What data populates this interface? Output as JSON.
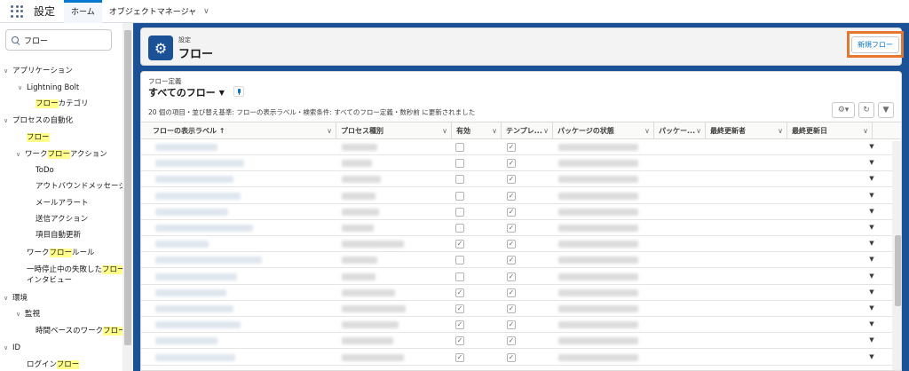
{
  "topbar": {
    "app_name": "設定",
    "tabs": [
      {
        "label": "ホーム",
        "active": true
      },
      {
        "label": "オブジェクトマネージャ",
        "active": false
      }
    ]
  },
  "sidebar": {
    "search_value": "フロー",
    "items": [
      {
        "caret": "∨",
        "text": "アプリケーション",
        "hl": ""
      },
      {
        "caret": "∨",
        "text": "Lightning Bolt",
        "hl": ""
      },
      {
        "pre": "",
        "hl": "フロー",
        "post": "カテゴリ"
      },
      {
        "caret": "∨",
        "text": "プロセスの自動化"
      },
      {
        "pre": "",
        "hl": "フロー",
        "post": ""
      },
      {
        "caret": "∨",
        "pre": "ワーク",
        "hl": "フロー",
        "post": "アクション"
      },
      {
        "text": "ToDo"
      },
      {
        "text": "アウトバウンドメッセージ"
      },
      {
        "text": "メールアラート"
      },
      {
        "text": "送信アクション"
      },
      {
        "text": "項目自動更新"
      },
      {
        "pre": "ワーク",
        "hl": "フロー",
        "post": "ルール"
      },
      {
        "pre": "一時停止中の失敗した",
        "hl": "フロー",
        "post": ""
      },
      {
        "text": "インタビュー"
      },
      {
        "caret": "∨",
        "text": "環境"
      },
      {
        "caret": "∨",
        "text": "監視"
      },
      {
        "pre": "時間ベースのワーク",
        "hl": "フロー",
        "post": ""
      },
      {
        "caret": "∨",
        "text": "ID"
      },
      {
        "pre": "ログイン",
        "hl": "フロー",
        "post": ""
      }
    ]
  },
  "header": {
    "breadcrumb": "設定",
    "title": "フロー",
    "new_button": "新規フロー",
    "icon": "gear-icon"
  },
  "list": {
    "label": "フロー定義",
    "view_name": "すべてのフロー",
    "status": "20 個の項目・並び替え基準: フローの表示ラベル・検索条件: すべてのフロー定義・数秒前 に更新されました"
  },
  "table": {
    "columns": [
      {
        "label": "フローの表示ラベル ↑"
      },
      {
        "label": "プロセス種別"
      },
      {
        "label": "有効"
      },
      {
        "label": "テンプレ..."
      },
      {
        "label": "パッケージの状態"
      },
      {
        "label": "パッケー..."
      },
      {
        "label": "最終更新者"
      },
      {
        "label": "最終更新日"
      }
    ],
    "rows": [
      {
        "active": false,
        "template": true
      },
      {
        "active": false,
        "template": true
      },
      {
        "active": false,
        "template": true
      },
      {
        "active": false,
        "template": true
      },
      {
        "active": false,
        "template": true
      },
      {
        "active": false,
        "template": true
      },
      {
        "active": true,
        "template": true
      },
      {
        "active": false,
        "template": true
      },
      {
        "active": false,
        "template": true
      },
      {
        "active": true,
        "template": true
      },
      {
        "active": true,
        "template": true
      },
      {
        "active": true,
        "template": true
      },
      {
        "active": true,
        "template": true
      },
      {
        "active": true,
        "template": true
      }
    ]
  },
  "colors": {
    "brand_blue": "#1b5297",
    "link_blue": "#0176d3",
    "highlight": "#ffff8a",
    "callout_orange": "#e8762c"
  }
}
